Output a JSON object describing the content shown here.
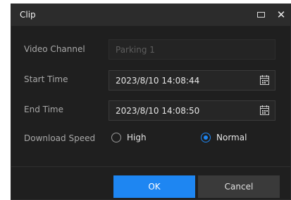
{
  "dialog": {
    "title": "Clip",
    "maximize_icon": "maximize-icon",
    "close_icon": "close-icon",
    "close_glyph": "✕"
  },
  "form": {
    "video_channel": {
      "label": "Video Channel",
      "value": "Parking 1",
      "disabled": true
    },
    "start_time": {
      "label": "Start Time",
      "value": "2023/8/10 14:08:44",
      "icon": "calendar-icon"
    },
    "end_time": {
      "label": "End Time",
      "value": "2023/8/10 14:08:50",
      "icon": "calendar-icon"
    },
    "download_speed": {
      "label": "Download Speed",
      "options": [
        "High",
        "Normal"
      ],
      "selected": "Normal"
    }
  },
  "buttons": {
    "ok": "OK",
    "cancel": "Cancel"
  },
  "colors": {
    "accent": "#1e86f2",
    "background": "#1f1f1f",
    "titlebar": "#2c2c2c"
  }
}
